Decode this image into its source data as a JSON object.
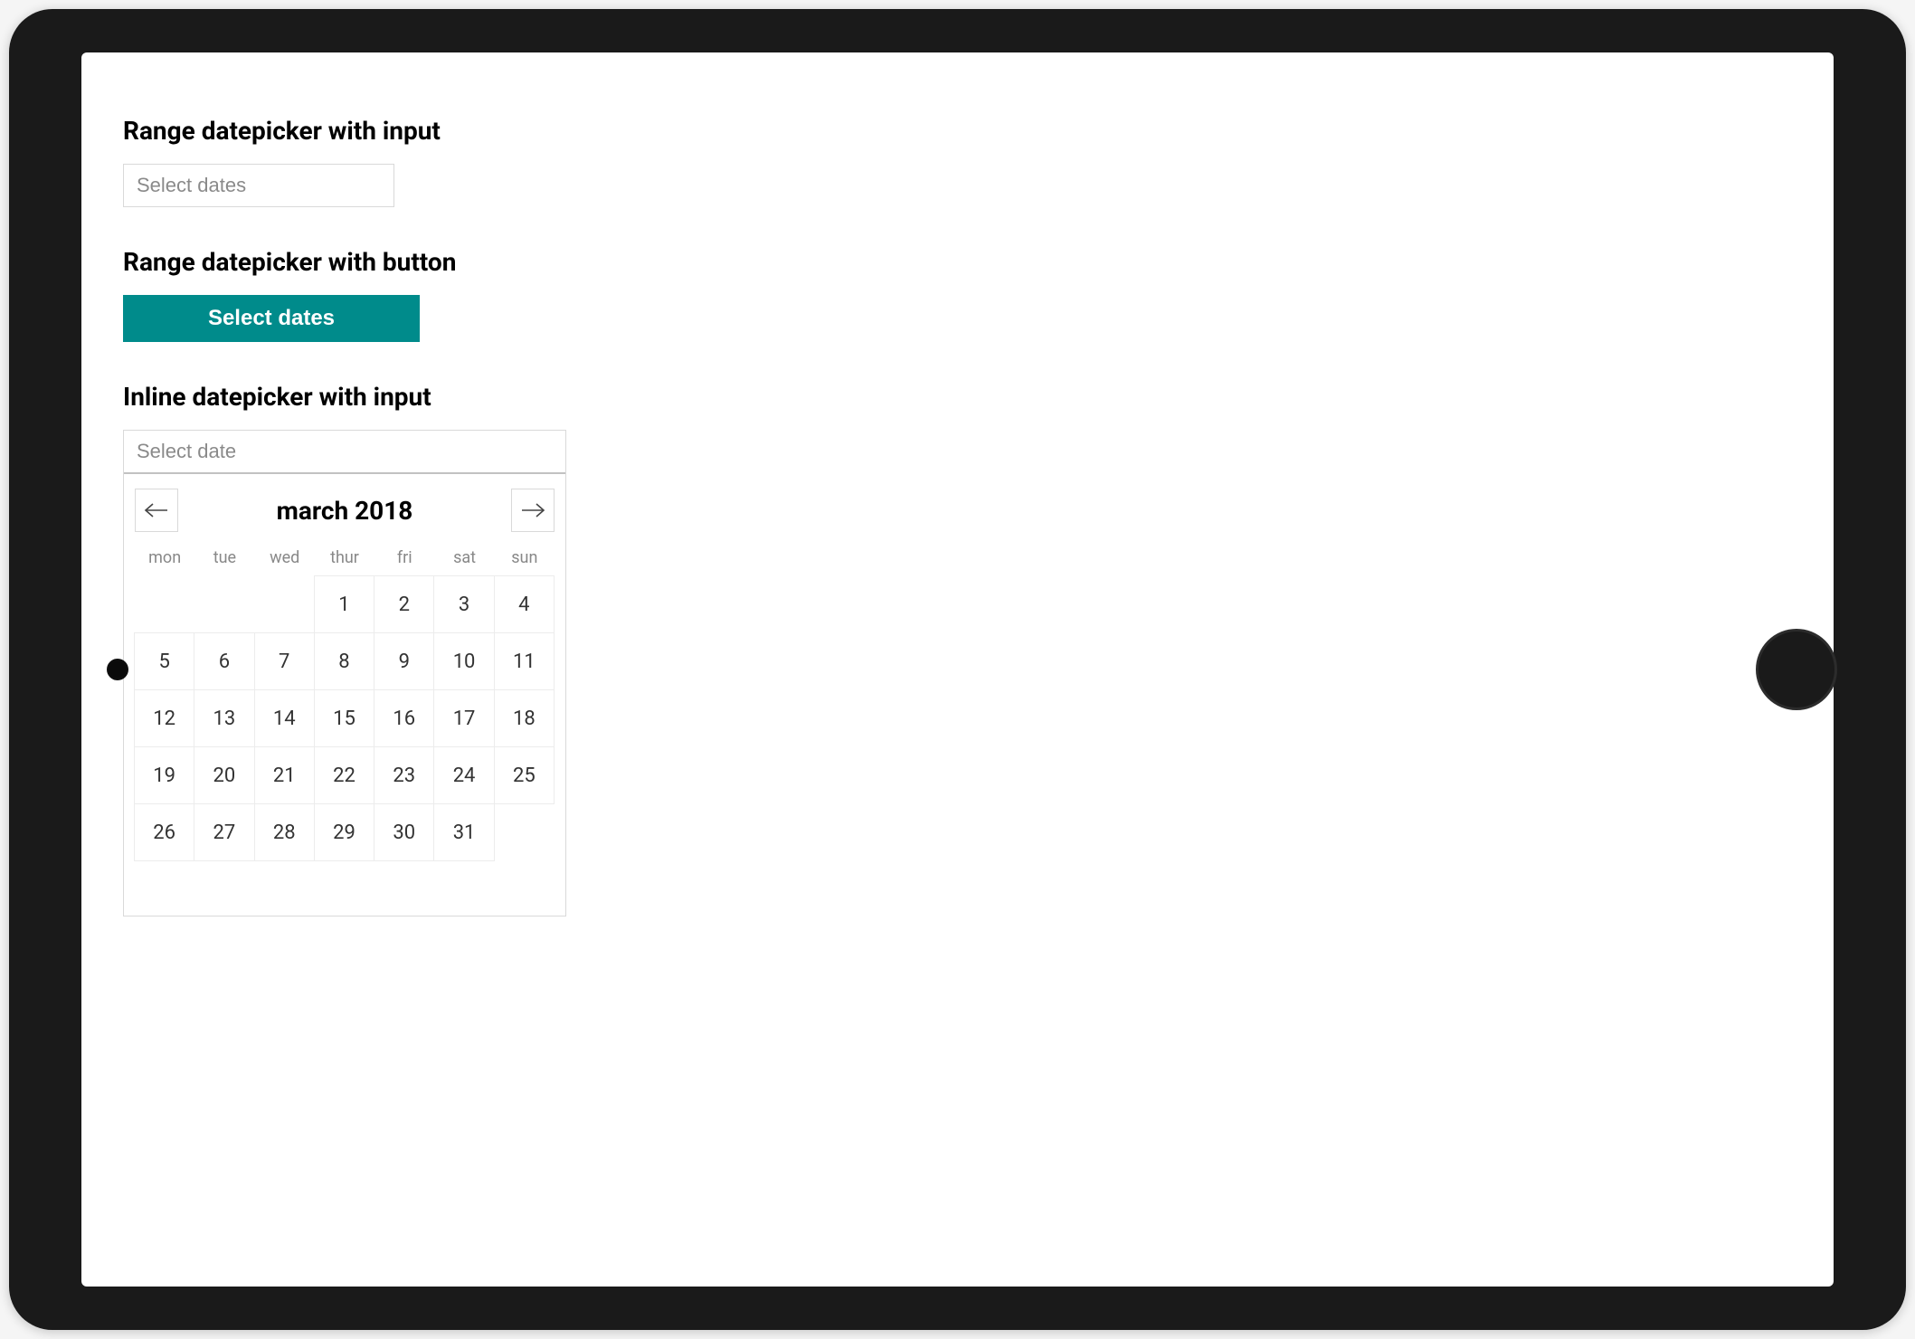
{
  "sections": {
    "range_input": {
      "heading": "Range datepicker with input",
      "placeholder": "Select dates"
    },
    "range_button": {
      "heading": "Range datepicker with button",
      "button_label": "Select dates"
    },
    "inline": {
      "heading": "Inline datepicker with input",
      "placeholder": "Select date"
    }
  },
  "calendar": {
    "month_title": "march 2018",
    "weekdays": [
      "mon",
      "tue",
      "wed",
      "thur",
      "fri",
      "sat",
      "sun"
    ],
    "leading_blanks": 3,
    "days_in_month": 31
  },
  "colors": {
    "primary": "#008b8b",
    "border": "#d9d9d9"
  }
}
